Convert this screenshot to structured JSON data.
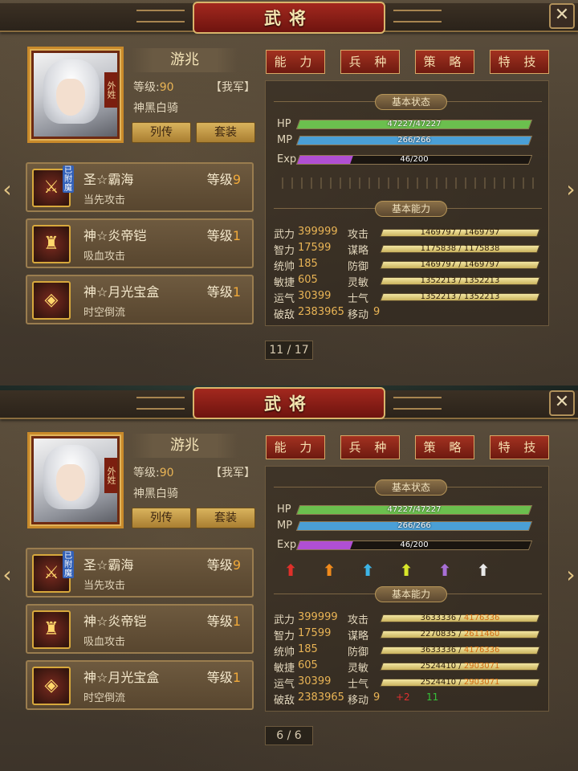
{
  "screen1": {
    "title": "武将",
    "close_label": "✕",
    "hero": {
      "name": "游兆",
      "level_label": "等级:",
      "level": "90",
      "faction": "【我军】",
      "mount": "神黑白骑",
      "portrait_tag": "外姓"
    },
    "buttons": {
      "biography": "列传",
      "set": "套装"
    },
    "tabs": [
      "能 力",
      "兵 种",
      "策 略",
      "特 技"
    ],
    "equipment": [
      {
        "name": "圣☆霸海",
        "level_label": "等级",
        "level": "9",
        "desc": "当先攻击",
        "badge": "已附魔",
        "icon": "sword-icon",
        "glyph": "⚔"
      },
      {
        "name": "神☆炎帝铠",
        "level_label": "等级",
        "level": "1",
        "desc": "吸血攻击",
        "badge": "",
        "icon": "armor-icon",
        "glyph": "♜"
      },
      {
        "name": "神☆月光宝盒",
        "level_label": "等级",
        "level": "1",
        "desc": "时空倒流",
        "badge": "",
        "icon": "box-icon",
        "glyph": "◈"
      }
    ],
    "status_header": "基本状态",
    "bars": [
      {
        "label": "HP",
        "text": "47227/47227",
        "ratio": 1.0,
        "color": "#6bbf4e"
      },
      {
        "label": "MP",
        "text": "266/266",
        "ratio": 1.0,
        "color": "#4a9fd6"
      },
      {
        "label": "Exp",
        "text": "46/200",
        "ratio": 0.23,
        "color": "#b04fd3"
      }
    ],
    "ability_header": "基本能力",
    "stats": [
      {
        "name": "武力",
        "value": "399999",
        "name2": "攻击",
        "bar": "1469797 / 1469797"
      },
      {
        "name": "智力",
        "value": "17599",
        "name2": "谋略",
        "bar": "1175838 / 1175838"
      },
      {
        "name": "统帅",
        "value": "185",
        "name2": "防御",
        "bar": "1469797 / 1469797"
      },
      {
        "name": "敏捷",
        "value": "605",
        "name2": "灵敏",
        "bar": "1352213 / 1352213"
      },
      {
        "name": "运气",
        "value": "30399",
        "name2": "士气",
        "bar": "1352213 / 1352213"
      }
    ],
    "defeat": {
      "name": "破敌",
      "value": "2383965",
      "name2": "移动",
      "move": "9"
    },
    "page": "11 / 17"
  },
  "screen2": {
    "title": "武将",
    "close_label": "✕",
    "strip_text": "90",
    "hero": {
      "name": "游兆",
      "level_label": "等级:",
      "level": "90",
      "faction": "【我军】",
      "mount": "神黑白骑",
      "portrait_tag": "外姓"
    },
    "buttons": {
      "biography": "列传",
      "set": "套装"
    },
    "tabs": [
      "能 力",
      "兵 种",
      "策 略",
      "特 技"
    ],
    "equipment": [
      {
        "name": "圣☆霸海",
        "level_label": "等级",
        "level": "9",
        "desc": "当先攻击",
        "badge": "已附魔",
        "icon": "sword-icon",
        "glyph": "⚔"
      },
      {
        "name": "神☆炎帝铠",
        "level_label": "等级",
        "level": "1",
        "desc": "吸血攻击",
        "badge": "",
        "icon": "armor-icon",
        "glyph": "♜"
      },
      {
        "name": "神☆月光宝盒",
        "level_label": "等级",
        "level": "1",
        "desc": "时空倒流",
        "badge": "",
        "icon": "box-icon",
        "glyph": "◈"
      }
    ],
    "status_header": "基本状态",
    "bars": [
      {
        "label": "HP",
        "text": "47227/47227",
        "ratio": 1.0,
        "color": "#6bbf4e"
      },
      {
        "label": "MP",
        "text": "266/266",
        "ratio": 1.0,
        "color": "#4a9fd6"
      },
      {
        "label": "Exp",
        "text": "46/200",
        "ratio": 0.23,
        "color": "#b04fd3"
      }
    ],
    "upgrade_arrows": [
      "#e0302a",
      "#f08a1c",
      "#3db4e6",
      "#d8e62a",
      "#a86fd6",
      "#e9e9e9"
    ],
    "ability_header": "基本能力",
    "stats": [
      {
        "name": "武力",
        "value": "399999",
        "name2": "攻击",
        "bar_a": "3633336 / ",
        "bar_b": "4176336"
      },
      {
        "name": "智力",
        "value": "17599",
        "name2": "谋略",
        "bar_a": "2270835 / ",
        "bar_b": "2611460"
      },
      {
        "name": "统帅",
        "value": "185",
        "name2": "防御",
        "bar_a": "3633336 / ",
        "bar_b": "4176336"
      },
      {
        "name": "敏捷",
        "value": "605",
        "name2": "灵敏",
        "bar_a": "2524410 / ",
        "bar_b": "2903071"
      },
      {
        "name": "运气",
        "value": "30399",
        "name2": "士气",
        "bar_a": "2524410 / ",
        "bar_b": "2903071"
      }
    ],
    "defeat": {
      "name": "破敌",
      "value": "2383965",
      "name2": "移动",
      "move": "9",
      "plus": "+2",
      "plus2": "11"
    },
    "page": "6 / 6"
  }
}
